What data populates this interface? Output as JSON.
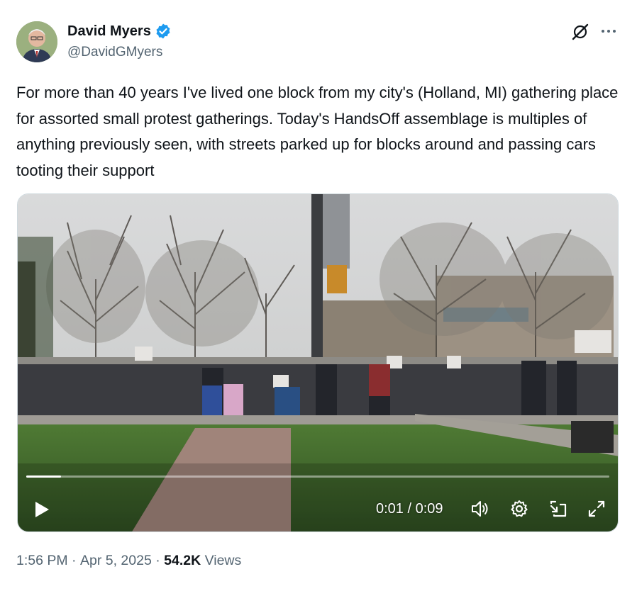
{
  "author": {
    "name": "David Myers",
    "handle": "@DavidGMyers",
    "verified": true,
    "avatar_icon": "person-avatar",
    "verified_color": "#1d9bf0"
  },
  "tweet": {
    "text": "For more than 40 years I've lived one block from my city's (Holland, MI) gathering place for assorted small protest gatherings. Today's HandsOff assemblage is multiples of anything previously seen, with streets parked up for blocks around and passing cars tooting their support"
  },
  "video": {
    "time_display": "0:01 / 0:09",
    "progress_fraction": 0.06,
    "icons": [
      "play-icon",
      "volume-icon",
      "settings-icon",
      "pip-icon",
      "fullscreen-icon"
    ]
  },
  "meta": {
    "time": "1:56 PM",
    "sep1": " · ",
    "date": "Apr 5, 2025",
    "sep2": " · ",
    "views_count": "54.2K",
    "views_label": " Views"
  },
  "colors": {
    "text": "#0f1419",
    "secondary": "#536471",
    "accent": "#1d9bf0"
  }
}
